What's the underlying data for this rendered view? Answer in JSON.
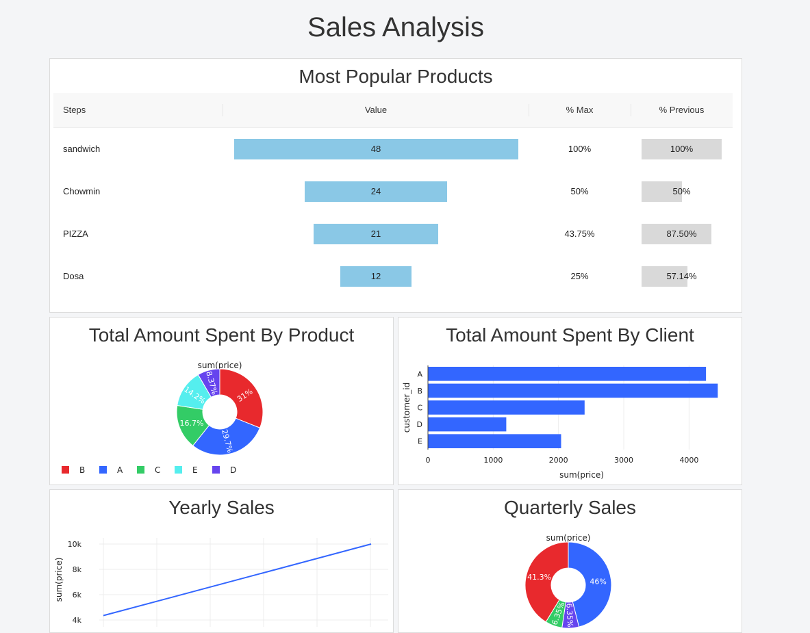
{
  "page_title": "Sales Analysis",
  "funnel": {
    "title": "Most Popular Products",
    "headers": [
      "Steps",
      "Value",
      "% Max",
      "% Previous"
    ],
    "rows": [
      {
        "step": "sandwich",
        "value": "48",
        "pct_max": "100%",
        "pct_prev": "100%",
        "value_num": 48,
        "prev_num": 1.0
      },
      {
        "step": "Chowmin",
        "value": "24",
        "pct_max": "50%",
        "pct_prev": "50%",
        "value_num": 24,
        "prev_num": 0.5
      },
      {
        "step": "PIZZA",
        "value": "21",
        "pct_max": "43.75%",
        "pct_prev": "87.50%",
        "value_num": 21,
        "prev_num": 0.875
      },
      {
        "step": "Dosa",
        "value": "12",
        "pct_max": "25%",
        "pct_prev": "57.14%",
        "value_num": 12,
        "prev_num": 0.5714
      }
    ]
  },
  "cards": {
    "product_title": "Total Amount Spent By Product",
    "client_title": "Total Amount Spent By Client",
    "yearly_title": "Yearly Sales",
    "quarterly_title": "Quarterly Sales"
  },
  "chart_data": [
    {
      "type": "pie",
      "title": "sum(price)",
      "donut": true,
      "labels": [
        "B",
        "A",
        "C",
        "E",
        "D"
      ],
      "values": [
        31,
        29.7,
        16.7,
        14.2,
        8.37
      ],
      "slice_labels": [
        "31%",
        "29.7%",
        "16.7%",
        "14.2%",
        "8.37%"
      ],
      "colors": [
        "#e8292d",
        "#3366ff",
        "#33cc66",
        "#55eeee",
        "#6644ee"
      ],
      "legend": "bottom"
    },
    {
      "type": "bar",
      "orientation": "horizontal",
      "categories": [
        "A",
        "B",
        "C",
        "D",
        "E"
      ],
      "values": [
        4260,
        4440,
        2400,
        1200,
        2040
      ],
      "xlabel": "sum(price)",
      "ylabel": "customer_id",
      "xlim": [
        0,
        4500
      ],
      "xticks": [
        "0",
        "1000",
        "2000",
        "3000",
        "4000"
      ],
      "color": "#3366ff",
      "grid": true
    },
    {
      "type": "line",
      "x": [
        0,
        1
      ],
      "y": [
        4350,
        10000
      ],
      "ylabel": "sum(price)",
      "yticks": [
        "4k",
        "6k",
        "8k",
        "10k"
      ],
      "color": "#3366ff",
      "grid": true
    },
    {
      "type": "pie",
      "title": "sum(price)",
      "donut": true,
      "values": [
        46,
        6.35,
        6.35,
        41.3
      ],
      "slice_labels": [
        "46%",
        "6.35%",
        "6.35%",
        "41.3%"
      ],
      "colors": [
        "#3366ff",
        "#6644ee",
        "#33cc66",
        "#e8292d"
      ]
    }
  ]
}
